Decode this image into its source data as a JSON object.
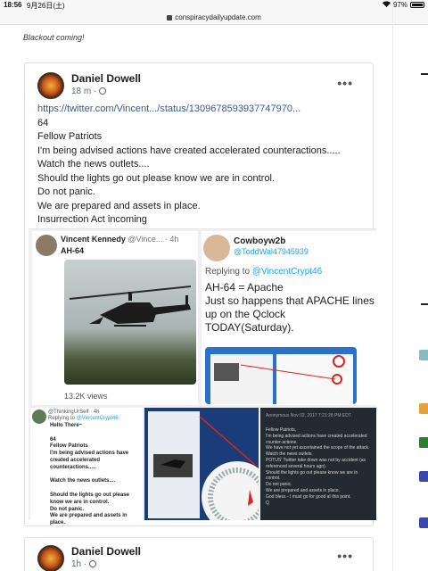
{
  "status_bar": {
    "time": "18:56",
    "date": "9月26日(土)",
    "battery_text": "97%",
    "battery_level": 0.97
  },
  "browser": {
    "url": "conspiracydailyupdate.com"
  },
  "article": {
    "caption": "Blackout coming!"
  },
  "post": {
    "author": "Daniel Dowell",
    "time": "18 m",
    "more_label": "•••",
    "link": "https://twitter.com/Vincent.../status/1309678593937747970...",
    "lines": [
      "64",
      "Fellow Patriots",
      "I'm being advised actions have created accelerated counteractions.....",
      "Watch the news outlets....",
      "Should the lights go out please know we are in control.",
      "Do not panic.",
      "We are prepared and assets in place.",
      "Insurrection Act incoming"
    ],
    "collage": {
      "tweet1": {
        "name": "Vincent Kennedy",
        "handle": "@Vince... · 4h",
        "text": "AH-64",
        "views": "13.2K views"
      },
      "tweet2": {
        "name": "Cowboyw2b",
        "handle": "@ToddWal47945939",
        "reply_prefix": "Replying to",
        "reply_to": "@VincentCrypt46",
        "text": "AH-64 = Apache\nJust so happens that APACHE lines up on the Qclock TODAY(Saturday)."
      },
      "tweet3": {
        "name": "@ThinkingUrSelf · 4h",
        "reply_prefix": "Replying to",
        "reply_to": "@VincentCrypt46",
        "text": "Hello There~\n\n64\nFellow Patriots\nI'm being advised actions have created accelerated counteractions.....\n\nWatch the news outlets....\n\nShould the lights go out please know we are in control.\nDo not panic.\nWe are prepared and assets in place."
      },
      "image5": {
        "header": "Anonymous  Nov 02, 2017 7:21:28 PM EDT",
        "text": "Fellow Patriots,\nI'm being advised actions have created accelerated counter-actions.\nWe have not yet ascertained the scope of the attack.\nWatch the news outlets.\nPOTUS' Twitter take down was not by accident (as referenced several hours ago).\nShould the lights go out please know we are in control.\nDo not panic.\nWe are prepared and assets in place.\nGod bless - I must go for good at this point.\nQ"
      }
    }
  },
  "post2": {
    "author": "Daniel Dowell",
    "time": "1h",
    "more_label": "•••"
  }
}
